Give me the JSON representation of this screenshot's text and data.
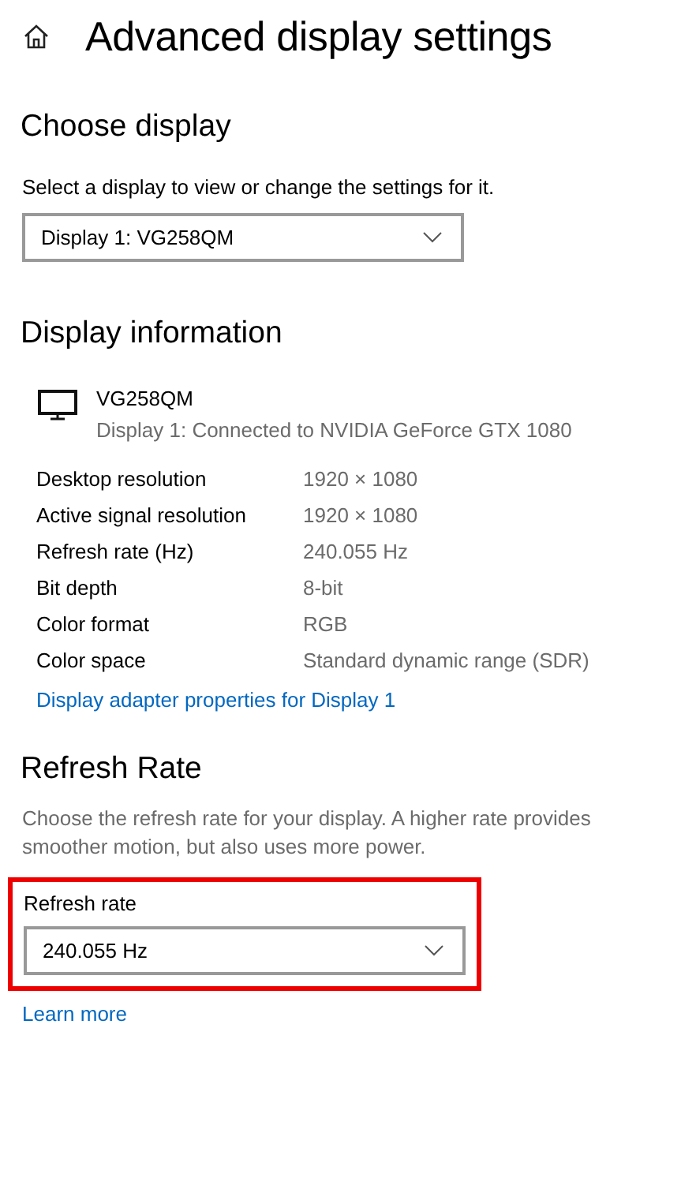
{
  "header": {
    "title": "Advanced display settings"
  },
  "choose_display": {
    "heading": "Choose display",
    "description": "Select a display to view or change the settings for it.",
    "dropdown": {
      "value": "Display 1: VG258QM"
    }
  },
  "display_information": {
    "heading": "Display information",
    "monitor_name": "VG258QM",
    "monitor_subtitle": "Display 1: Connected to NVIDIA GeForce GTX 1080",
    "rows": [
      {
        "label": "Desktop resolution",
        "value": "1920 × 1080"
      },
      {
        "label": "Active signal resolution",
        "value": "1920 × 1080"
      },
      {
        "label": "Refresh rate (Hz)",
        "value": "240.055 Hz"
      },
      {
        "label": "Bit depth",
        "value": "8-bit"
      },
      {
        "label": "Color format",
        "value": "RGB"
      },
      {
        "label": "Color space",
        "value": "Standard dynamic range (SDR)"
      }
    ],
    "link": "Display adapter properties for Display 1"
  },
  "refresh_rate": {
    "heading": "Refresh Rate",
    "description": "Choose the refresh rate for your display. A higher rate provides smoother motion, but also uses more power.",
    "highlighted": true,
    "field_label": "Refresh rate",
    "dropdown": {
      "value": "240.055 Hz"
    },
    "link": "Learn more"
  }
}
